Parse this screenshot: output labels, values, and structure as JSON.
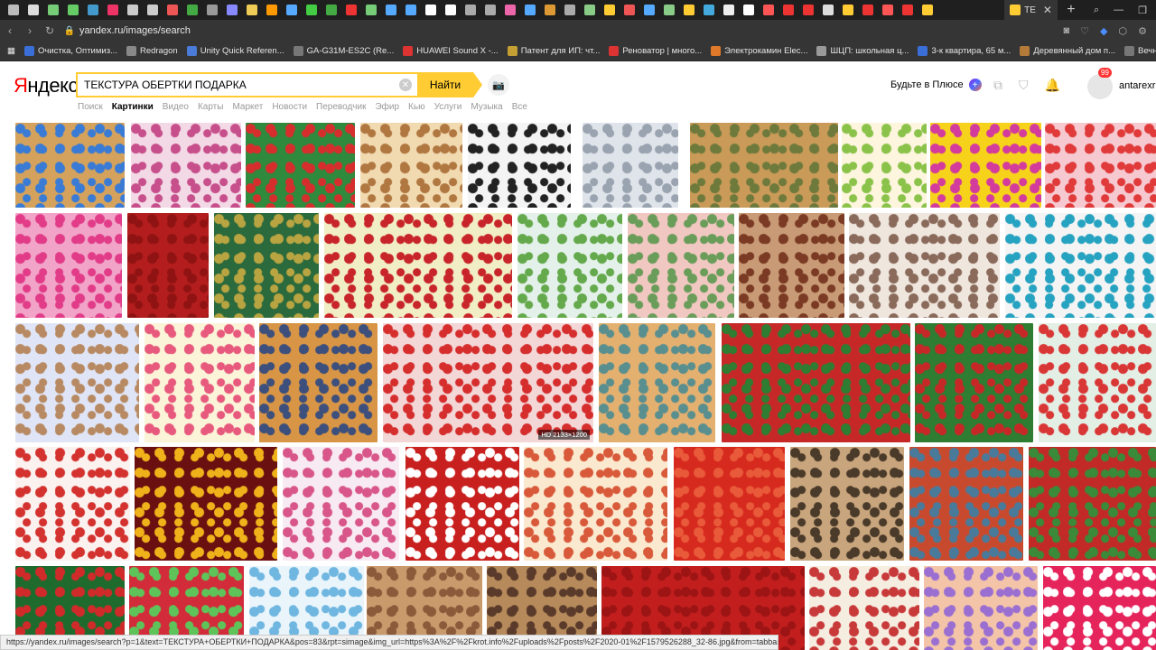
{
  "browser": {
    "active_tab_title": "TE",
    "url": "yandex.ru/images/search",
    "bookmarks": [
      {
        "label": "Очистка, Оптимиз...",
        "color": "#3a6fd8"
      },
      {
        "label": "Redragon",
        "color": "#888"
      },
      {
        "label": "Unity Quick Referen...",
        "color": "#4b7bd8"
      },
      {
        "label": "GA-G31M-ES2C (Re...",
        "color": "#777"
      },
      {
        "label": "HUAWEI Sound X -...",
        "color": "#d33"
      },
      {
        "label": "Патент для ИП: чт...",
        "color": "#c4a034"
      },
      {
        "label": "Реноватор | много...",
        "color": "#d33"
      },
      {
        "label": "Электрокамин Elec...",
        "color": "#e07a2a"
      },
      {
        "label": "ШЦП: школьная ц...",
        "color": "#999"
      },
      {
        "label": "3-к квартира, 65 м...",
        "color": "#3a6fd8"
      },
      {
        "label": "Деревянный дом п...",
        "color": "#b37a3a"
      },
      {
        "label": "Вечные ссылки и с...",
        "color": "#777"
      }
    ]
  },
  "yandex": {
    "logo": "Яндекс",
    "search_query": "ТЕКСТУРА ОБЕРТКИ ПОДАРКА",
    "search_button": "Найти",
    "plus_label": "Будьте в Плюсе",
    "notification_count": "99",
    "username": "antarexru",
    "nav": [
      "Поиск",
      "Картинки",
      "Видео",
      "Карты",
      "Маркет",
      "Новости",
      "Переводчик",
      "Эфир",
      "Кью",
      "Услуги",
      "Музыка",
      "Все"
    ]
  },
  "results": {
    "hd_label": "HD 2133×1200"
  },
  "status_url": "https://yandex.ru/images/search?p=1&text=ТЕКСТУРА+ОБЕРТКИ+ПОДАРКА&pos=83&rpt=simage&img_url=https%3A%2F%2Fkrot.info%2Fuploads%2Fposts%2F2020-01%2F1579526288_32-86.jpg&from=tabbar"
}
